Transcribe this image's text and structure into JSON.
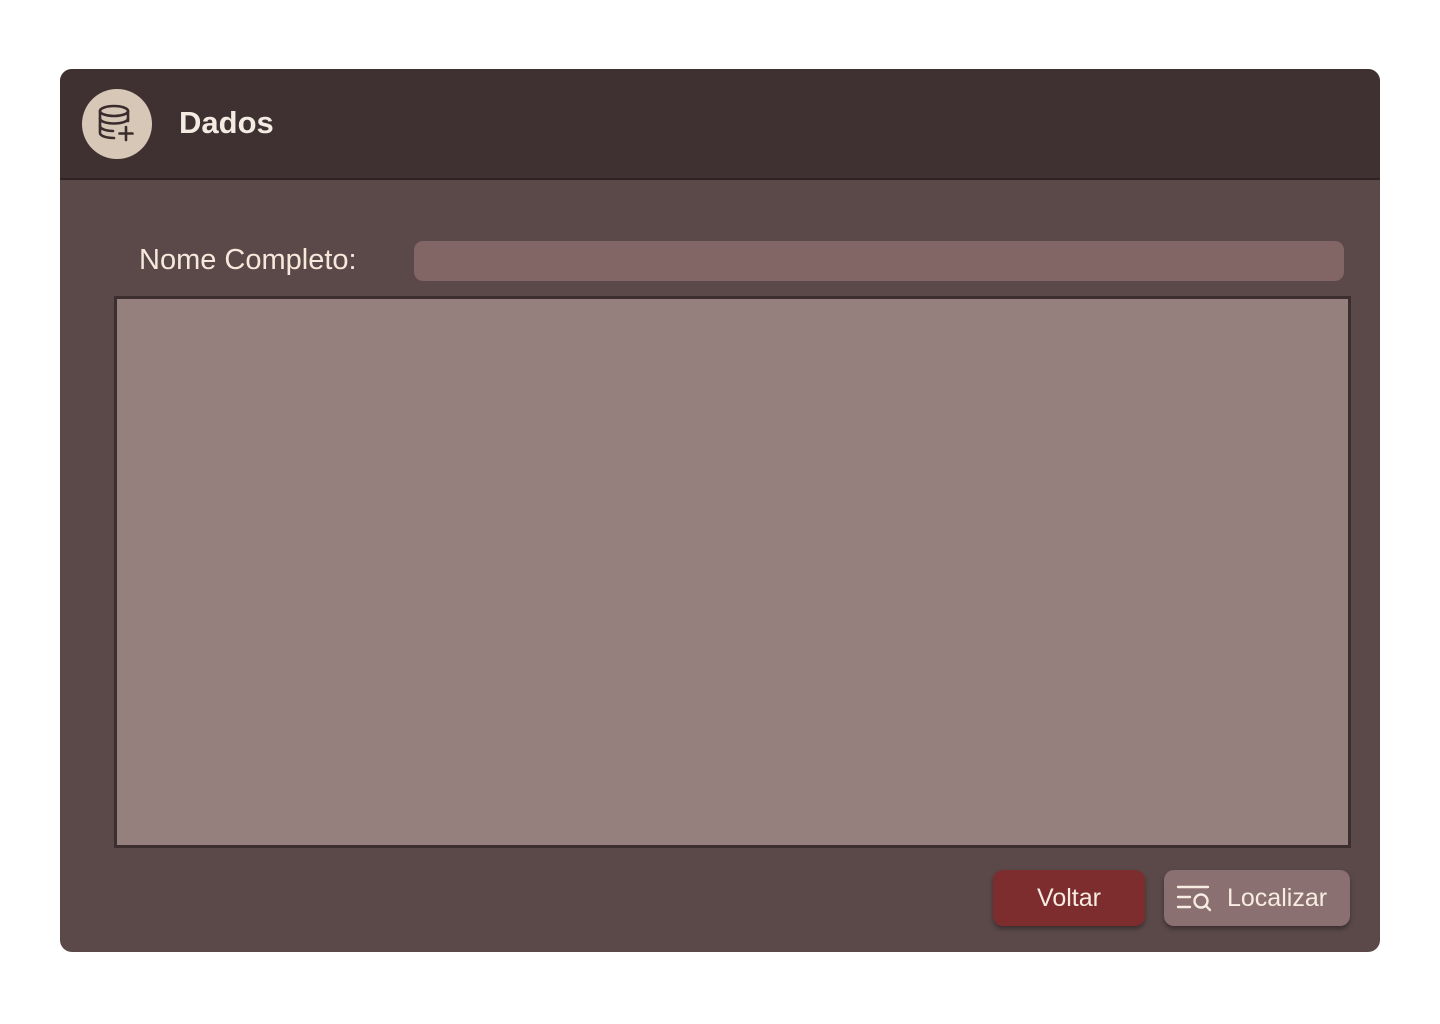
{
  "header": {
    "title": "Dados",
    "icon": "database-add-icon"
  },
  "form": {
    "name_label": "Nome Completo:",
    "name_value": "",
    "name_placeholder": ""
  },
  "results": {
    "items": []
  },
  "actions": {
    "back_label": "Voltar",
    "search_label": "Localizar",
    "search_icon": "list-search-icon"
  },
  "colors": {
    "header_bg": "#3f3131",
    "body_bg": "#5b4949",
    "input_bg": "#826565",
    "results_bg": "#96807e",
    "back_button": "#7e2d2f",
    "search_button": "#8a7070",
    "avatar_bg": "#d6c7b7"
  }
}
